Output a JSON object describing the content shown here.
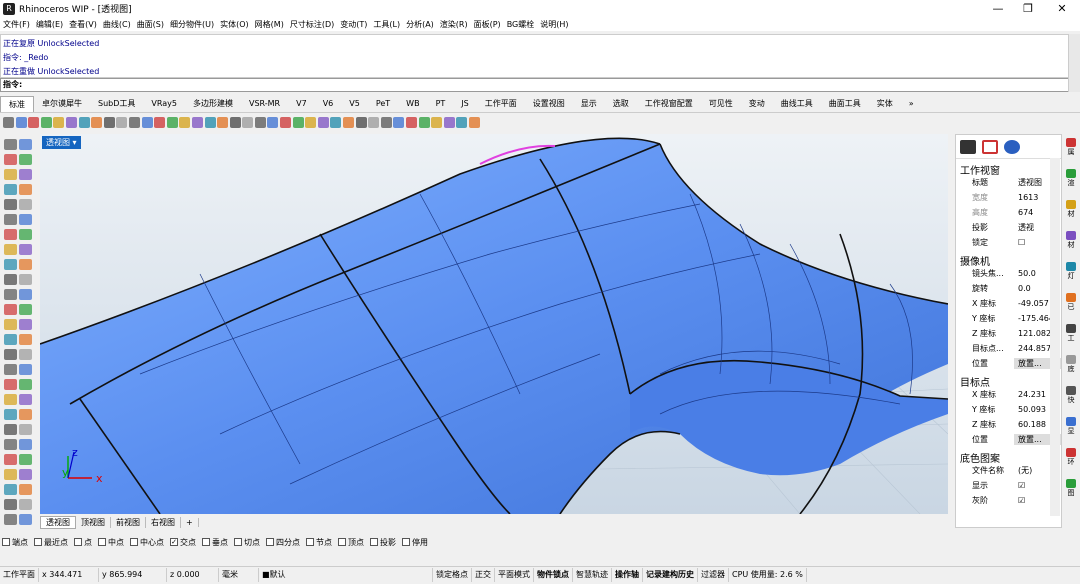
{
  "window": {
    "title": "Rhinoceros WIP - [透视图]",
    "min": "—",
    "max": "❐",
    "close": "✕"
  },
  "menu": [
    "文件(F)",
    "编辑(E)",
    "查看(V)",
    "曲线(C)",
    "曲面(S)",
    "细分物件(U)",
    "实体(O)",
    "网格(M)",
    "尺寸标注(D)",
    "变动(T)",
    "工具(L)",
    "分析(A)",
    "渲染(R)",
    "面板(P)",
    "BG螺栓",
    "说明(H)"
  ],
  "history": [
    "正在复原 UnlockSelected",
    "指令: _Redo",
    "正在重做 UnlockSelected"
  ],
  "command_prompt": "指令:",
  "tabs": [
    "标准",
    "卓尔谟犀牛",
    "SubD工具",
    "VRay5",
    "多边形建模",
    "VSR-MR",
    "V7",
    "V6",
    "V5",
    "PeT",
    "WB",
    "PT",
    "JS",
    "工作平面",
    "设置视图",
    "显示",
    "选取",
    "工作视窗配置",
    "可见性",
    "变动",
    "曲线工具",
    "曲面工具",
    "实体"
  ],
  "tab_more": "»",
  "viewport": {
    "label": "透视图 ▾",
    "axis_x": "x",
    "axis_y": "y",
    "axis_z": "z"
  },
  "viewport_tabs": [
    "透视图",
    "顶视图",
    "前视图",
    "右视图",
    "+"
  ],
  "osnaps": [
    {
      "label": "端点",
      "checked": false
    },
    {
      "label": "最近点",
      "checked": false
    },
    {
      "label": "点",
      "checked": false
    },
    {
      "label": "中点",
      "checked": false
    },
    {
      "label": "中心点",
      "checked": false
    },
    {
      "label": "交点",
      "checked": true
    },
    {
      "label": "垂点",
      "checked": false
    },
    {
      "label": "切点",
      "checked": false
    },
    {
      "label": "四分点",
      "checked": false
    },
    {
      "label": "节点",
      "checked": false
    },
    {
      "label": "顶点",
      "checked": false
    },
    {
      "label": "投影",
      "checked": false
    },
    {
      "label": "停用",
      "checked": false
    }
  ],
  "status": {
    "cplane": "工作平面",
    "x": "x 344.471",
    "y": "y 865.994",
    "z": "z 0.000",
    "unit": "毫米",
    "layer": "■默认",
    "items": [
      "锁定格点",
      "正交",
      "平面模式",
      "物件锁点",
      "智慧轨迹",
      "操作轴",
      "记录建构历史",
      "过滤器",
      "CPU 使用量: 2.6 %"
    ]
  },
  "panel": {
    "section_viewport": "工作视窗",
    "viewport_rows": [
      {
        "k": "标题",
        "v": "透视图"
      },
      {
        "k": "宽度",
        "v": "1613"
      },
      {
        "k": "高度",
        "v": "674"
      },
      {
        "k": "投影",
        "v": "透视"
      },
      {
        "k": "锁定",
        "v": "☐"
      }
    ],
    "section_camera": "摄像机",
    "camera_rows": [
      {
        "k": "镜头焦...",
        "v": "50.0"
      },
      {
        "k": "旋转",
        "v": "0.0"
      },
      {
        "k": "X 座标",
        "v": "-49.057"
      },
      {
        "k": "Y 座标",
        "v": "-175.464"
      },
      {
        "k": "Z 座标",
        "v": "121.082"
      },
      {
        "k": "目标点...",
        "v": "244.857"
      },
      {
        "k": "位置",
        "v": "放置..."
      }
    ],
    "section_target": "目标点",
    "target_rows": [
      {
        "k": "X 座标",
        "v": "24.231"
      },
      {
        "k": "Y 座标",
        "v": "50.093"
      },
      {
        "k": "Z 座标",
        "v": "60.188"
      },
      {
        "k": "位置",
        "v": "放置..."
      }
    ],
    "section_bg": "底色图案",
    "bg_rows": [
      {
        "k": "文件名称",
        "v": "(无)"
      },
      {
        "k": "显示",
        "v": "☑"
      },
      {
        "k": "灰阶",
        "v": "☑"
      }
    ]
  },
  "rightstrip": [
    "属",
    "渲",
    "材",
    "材",
    "灯",
    "已",
    "工",
    "底",
    "快",
    "显",
    "环",
    "图"
  ],
  "colors": {
    "surface": "#5b8ff0",
    "highlight": "#e040e0",
    "viewport_bg": "#dfe7ef",
    "accent": "#1565c0"
  }
}
